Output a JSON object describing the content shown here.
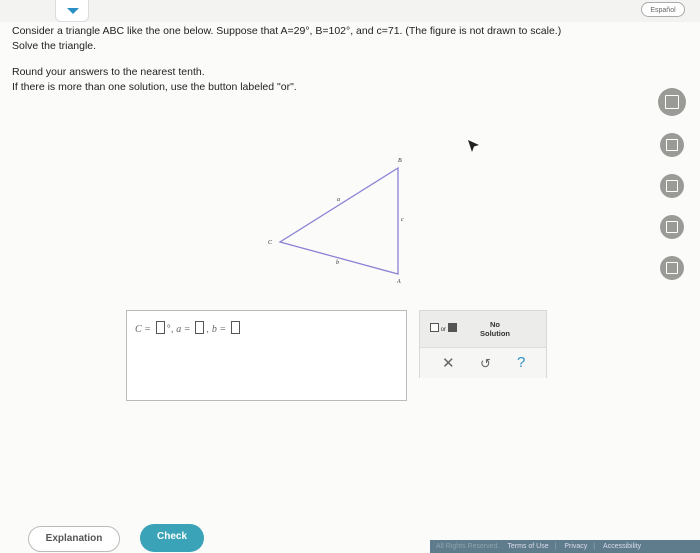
{
  "header": {
    "language_button": "Español"
  },
  "problem": {
    "line1": "Consider a triangle ABC like the one below. Suppose that A=29°, B=102°, and c=71. (The figure is not drawn to scale.)",
    "line2": "Solve the triangle.",
    "line3": "Round your answers to the nearest tenth.",
    "line4": "If there is more than one solution, use the button labeled \"or\"."
  },
  "figure": {
    "vertex_b": "B",
    "vertex_c": "C",
    "vertex_a": "A",
    "side_a": "a",
    "side_b": "b",
    "side_c": "c"
  },
  "answer": {
    "c_label": "C =",
    "deg": "°,",
    "a_label": "a =",
    "comma": ",",
    "b_label": "b ="
  },
  "keypad": {
    "or_label": "or",
    "no_solution_line1": "No",
    "no_solution_line2": "Solution",
    "clear_symbol": "✕",
    "undo_symbol": "↺",
    "help_symbol": "?"
  },
  "footer": {
    "explanation_label": "Explanation",
    "check_label": "Check",
    "rights": "All Rights Reserved.",
    "terms": "Terms of Use",
    "privacy": "Privacy",
    "accessibility": "Accessibility"
  }
}
